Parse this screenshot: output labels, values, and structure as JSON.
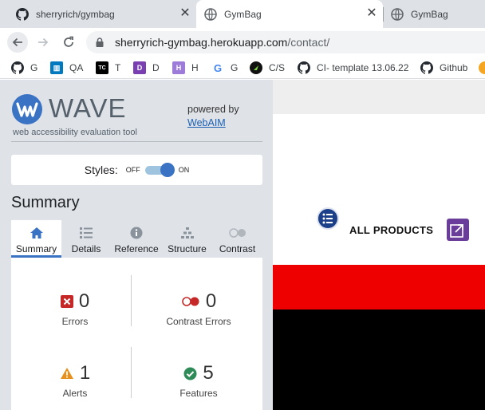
{
  "browser": {
    "tabs": [
      {
        "title": "sherryrich/gymbag",
        "close": "✕"
      },
      {
        "title": "GymBag",
        "close": "✕"
      },
      {
        "title": "GymBag"
      }
    ],
    "url": {
      "host": "sherryrich-gymbag.herokuapp.com",
      "path": "/contact/"
    },
    "bookmarks": [
      {
        "label": "G",
        "icon": "github-icon"
      },
      {
        "label": "QA",
        "icon": "trello-icon"
      },
      {
        "label": "T",
        "icon": "teamcity-icon"
      },
      {
        "label": "D",
        "icon": "purple-d-icon"
      },
      {
        "label": "H",
        "icon": "heroku-icon"
      },
      {
        "label": "G",
        "icon": "google-icon"
      },
      {
        "label": "C/S",
        "icon": "codestar-icon"
      },
      {
        "label": "CI- template 13.06.22",
        "icon": "github-icon"
      },
      {
        "label": "Github",
        "icon": "github-icon"
      }
    ]
  },
  "wave": {
    "logo_text": "WAVE",
    "tagline": "web accessibility evaluation tool",
    "powered_by": "powered by",
    "webaim_link": "WebAIM",
    "styles": {
      "label": "Styles:",
      "off": "OFF",
      "on": "ON",
      "state": "on"
    },
    "summary_title": "Summary",
    "tabs": [
      {
        "label": "Summary",
        "icon": "home-icon",
        "active": true
      },
      {
        "label": "Details",
        "icon": "list-icon"
      },
      {
        "label": "Reference",
        "icon": "info-icon"
      },
      {
        "label": "Structure",
        "icon": "structure-icon"
      },
      {
        "label": "Contrast",
        "icon": "contrast-icon"
      }
    ],
    "stats": {
      "errors": {
        "count": "0",
        "label": "Errors"
      },
      "contrast_errors": {
        "count": "0",
        "label": "Contrast Errors"
      },
      "alerts": {
        "count": "1",
        "label": "Alerts"
      },
      "features": {
        "count": "5",
        "label": "Features"
      }
    },
    "colors": {
      "error": "#d0312d",
      "alert": "#e8901e",
      "feature": "#2e8b57",
      "accent": "#3a72c4"
    }
  },
  "page": {
    "nav_label": "ALL PRODUCTS",
    "colors": {
      "red_band": "#ee0000",
      "black_band": "#000000",
      "icon_blue": "#1c3f8a",
      "wave_marker": "#6b3d9a"
    }
  }
}
